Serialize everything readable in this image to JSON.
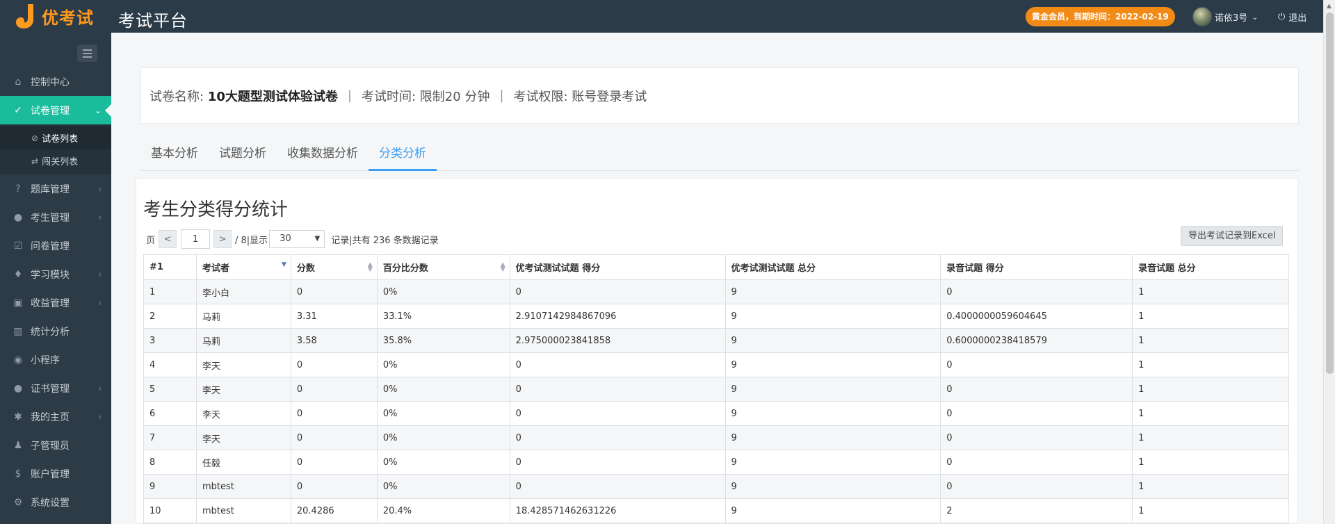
{
  "header": {
    "logo_text": "优考试",
    "platform_title": "考试平台",
    "vip_badge": "黄金会员，到期时间：2022-02-19",
    "user_name": "诺依3号",
    "logout_label": "退出",
    "colors": {
      "topbar": "#2c3b48",
      "badge": "#f28a16",
      "logo": "#ff9a1f"
    }
  },
  "sidebar": {
    "items": [
      {
        "label": "控制中心",
        "icon": "home-icon",
        "has_children": false
      },
      {
        "label": "试卷管理",
        "icon": "check-circle-icon",
        "has_children": true,
        "active": true
      },
      {
        "label": "题库管理",
        "icon": "question-circle-icon",
        "has_children": true
      },
      {
        "label": "考生管理",
        "icon": "user-icon",
        "has_children": true
      },
      {
        "label": "问卷管理",
        "icon": "checkbox-icon",
        "has_children": false
      },
      {
        "label": "学习模块",
        "icon": "graduation-cap-icon",
        "has_children": true
      },
      {
        "label": "收益管理",
        "icon": "money-icon",
        "has_children": true
      },
      {
        "label": "统计分析",
        "icon": "bar-chart-icon",
        "has_children": false
      },
      {
        "label": "小程序",
        "icon": "wechat-icon",
        "has_children": false
      },
      {
        "label": "证书管理",
        "icon": "certificate-icon",
        "has_children": true
      },
      {
        "label": "我的主页",
        "icon": "leaf-icon",
        "has_children": true
      },
      {
        "label": "子管理员",
        "icon": "user-tie-icon",
        "has_children": false
      },
      {
        "label": "账户管理",
        "icon": "dollar-icon",
        "has_children": false
      },
      {
        "label": "系统设置",
        "icon": "gear-icon",
        "has_children": false
      }
    ],
    "submenu": [
      {
        "label": "试卷列表",
        "icon": "check-circle-icon",
        "active": true
      },
      {
        "label": "闯关列表",
        "icon": "shuffle-icon"
      }
    ],
    "accent": "#1abc9c"
  },
  "exam_info": {
    "name_label": "试卷名称:",
    "name_value": "10大题型测试体验试卷",
    "time_text": "考试时间: 限制20 分钟",
    "permission_text": "考试权限: 账号登录考试",
    "separator": "|"
  },
  "tabs": [
    {
      "label": "基本分析"
    },
    {
      "label": "试题分析"
    },
    {
      "label": "收集数据分析"
    },
    {
      "label": "分类分析",
      "active": true
    }
  ],
  "panel": {
    "title": "考生分类得分统计",
    "pager": {
      "page_label": "页",
      "prev": "<",
      "current_page": "1",
      "next": ">",
      "total_text": "/ 8|显示",
      "page_size": "30",
      "records_text": "记录|共有 236 条数据记录"
    },
    "export_label": "导出考试记录到Excel"
  },
  "table": {
    "columns": [
      "#1",
      "考试者",
      "分数",
      "百分比分数",
      "优考试测试试题 得分",
      "优考试测试试题 总分",
      "录音试题 得分",
      "录音试题 总分"
    ],
    "rows": [
      [
        "1",
        "李小白",
        "0",
        "0%",
        "0",
        "9",
        "0",
        "1"
      ],
      [
        "2",
        "马莉",
        "3.31",
        "33.1%",
        "2.9107142984867096",
        "9",
        "0.4000000059604645",
        "1"
      ],
      [
        "3",
        "马莉",
        "3.58",
        "35.8%",
        "2.975000023841858",
        "9",
        "0.6000000238418579",
        "1"
      ],
      [
        "4",
        "李天",
        "0",
        "0%",
        "0",
        "9",
        "0",
        "1"
      ],
      [
        "5",
        "李天",
        "0",
        "0%",
        "0",
        "9",
        "0",
        "1"
      ],
      [
        "6",
        "李天",
        "0",
        "0%",
        "0",
        "9",
        "0",
        "1"
      ],
      [
        "7",
        "李天",
        "0",
        "0%",
        "0",
        "9",
        "0",
        "1"
      ],
      [
        "8",
        "任毅",
        "0",
        "0%",
        "0",
        "9",
        "0",
        "1"
      ],
      [
        "9",
        "mbtest",
        "0",
        "0%",
        "0",
        "9",
        "0",
        "1"
      ],
      [
        "10",
        "mbtest",
        "20.4286",
        "20.4%",
        "18.428571462631226",
        "9",
        "2",
        "1"
      ]
    ]
  }
}
